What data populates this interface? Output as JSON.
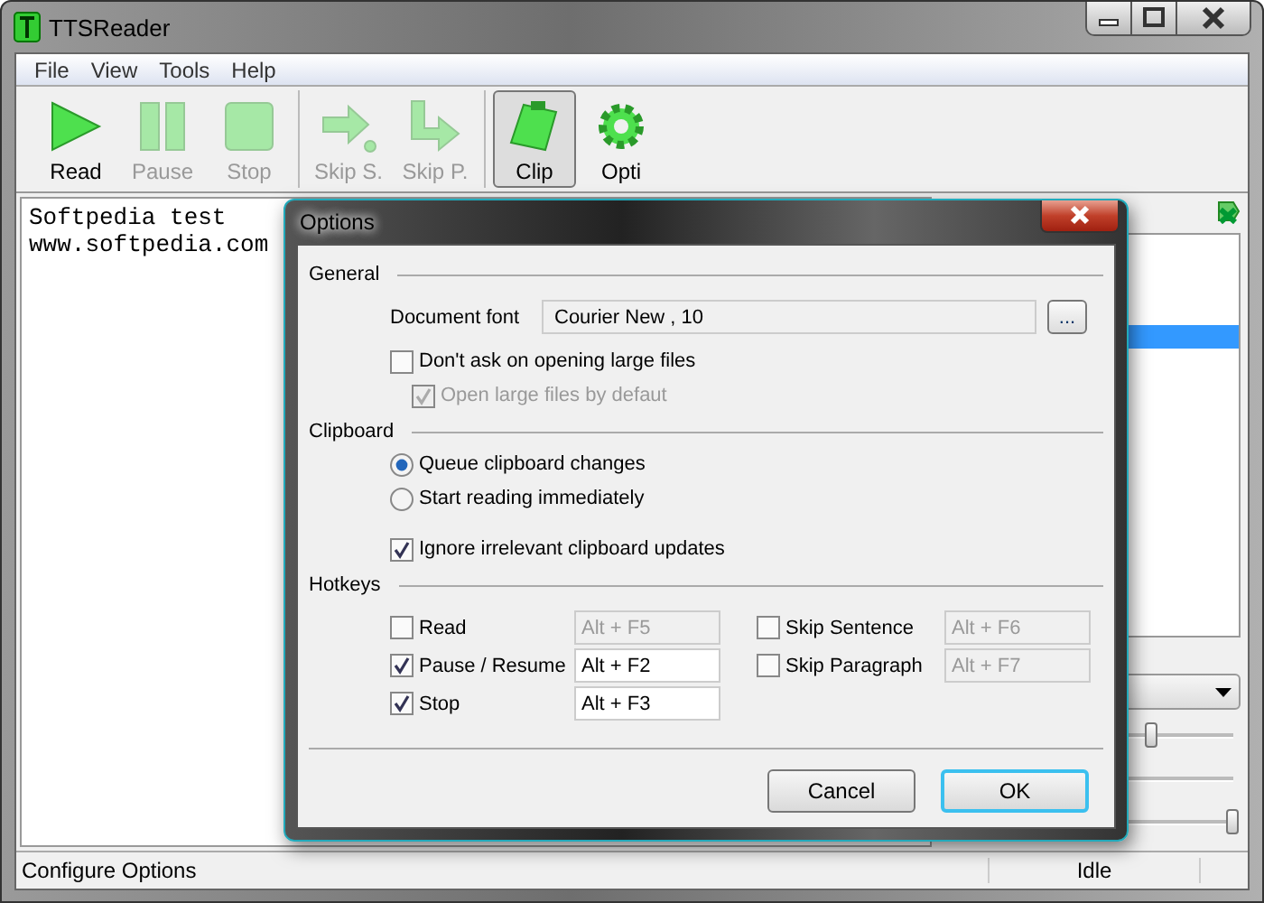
{
  "window": {
    "title": "TTSReader"
  },
  "menu": [
    "File",
    "View",
    "Tools",
    "Help"
  ],
  "toolbar": [
    [
      {
        "kind": "play",
        "label": "Read",
        "disabled": false,
        "pressed": false
      },
      {
        "kind": "pause",
        "label": "Pause",
        "disabled": true,
        "pressed": false
      },
      {
        "kind": "stop",
        "label": "Stop",
        "disabled": true,
        "pressed": false
      }
    ],
    [
      {
        "kind": "skip-sentence",
        "label": "Skip S.",
        "disabled": true,
        "pressed": false
      },
      {
        "kind": "skip-paragraph",
        "label": "Skip P.",
        "disabled": true,
        "pressed": false
      }
    ],
    [
      {
        "kind": "clip",
        "label": "Clip",
        "disabled": false,
        "pressed": true
      },
      {
        "kind": "gear",
        "label": "Opti",
        "disabled": false,
        "pressed": false
      }
    ]
  ],
  "document": {
    "lines": [
      "Softpedia test",
      "www.softpedia.com"
    ]
  },
  "side_panel": {
    "sliders": [
      {
        "level": 0.7
      },
      {
        "level": 1
      }
    ]
  },
  "status_bar": {
    "message": "Configure Options",
    "state": "Idle"
  },
  "dialog": {
    "title": "Options",
    "general": {
      "heading": "General",
      "font_label": "Document font",
      "font_value": "Courier New , 10",
      "browse": "...",
      "checkboxes": [
        {
          "label": "Don't ask on opening large files",
          "checked": false,
          "disabled": false,
          "children": [
            {
              "label": "Open large files by defaut",
              "checked": true,
              "disabled": true
            }
          ]
        }
      ]
    },
    "clipboard": {
      "heading": "Clipboard",
      "radios": [
        {
          "label": "Queue clipboard changes",
          "selected": true
        },
        {
          "label": "Start reading immediately",
          "selected": false
        }
      ],
      "checkboxes": [
        {
          "label": "Ignore irrelevant clipboard updates",
          "checked": true,
          "disabled": false
        }
      ]
    },
    "hotkeys": {
      "heading": "Hotkeys",
      "columns": [
        [
          {
            "label": "Read",
            "checked": false,
            "key": "Alt + F5"
          },
          {
            "label": "Pause / Resume",
            "checked": true,
            "key": "Alt + F2"
          },
          {
            "label": "Stop",
            "checked": true,
            "key": "Alt + F3"
          }
        ],
        [
          {
            "label": "Skip Sentence",
            "checked": false,
            "key": "Alt + F6"
          },
          {
            "label": "Skip Paragraph",
            "checked": false,
            "key": "Alt + F7"
          }
        ]
      ]
    },
    "buttons": [
      {
        "label": "Cancel",
        "default": false
      },
      {
        "label": "OK",
        "default": true
      }
    ]
  }
}
